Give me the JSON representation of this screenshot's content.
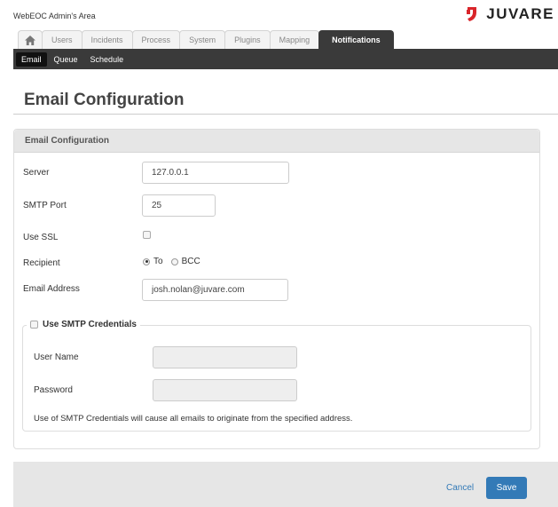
{
  "header": {
    "app_title": "WebEOC Admin's Area",
    "logo_text": "JUVARE",
    "logo_color": "#d9252a"
  },
  "tabs": [
    {
      "label": "",
      "icon": "home-icon"
    },
    {
      "label": "Users"
    },
    {
      "label": "Incidents"
    },
    {
      "label": "Process"
    },
    {
      "label": "System"
    },
    {
      "label": "Plugins"
    },
    {
      "label": "Mapping"
    },
    {
      "label": "Notifications",
      "active": true
    }
  ],
  "subnav": [
    {
      "label": "Email",
      "active": true
    },
    {
      "label": "Queue"
    },
    {
      "label": "Schedule"
    }
  ],
  "page": {
    "title": "Email Configuration"
  },
  "panel": {
    "heading": "Email Configuration",
    "server": {
      "label": "Server",
      "value": "127.0.0.1"
    },
    "smtp_port": {
      "label": "SMTP Port",
      "value": "25"
    },
    "use_ssl": {
      "label": "Use SSL",
      "checked": false
    },
    "recipient": {
      "label": "Recipient",
      "options": [
        "To",
        "BCC"
      ],
      "selected": "To"
    },
    "email_address": {
      "label": "Email Address",
      "value": "josh.nolan@juvare.com"
    },
    "credentials": {
      "legend": "Use SMTP Credentials",
      "checked": false,
      "user_name": {
        "label": "User Name",
        "value": ""
      },
      "password": {
        "label": "Password",
        "value": ""
      },
      "note": "Use of SMTP Credentials will cause all emails to originate from the specified address."
    }
  },
  "footer": {
    "cancel_label": "Cancel",
    "save_label": "Save",
    "accent": "#337ab7"
  }
}
